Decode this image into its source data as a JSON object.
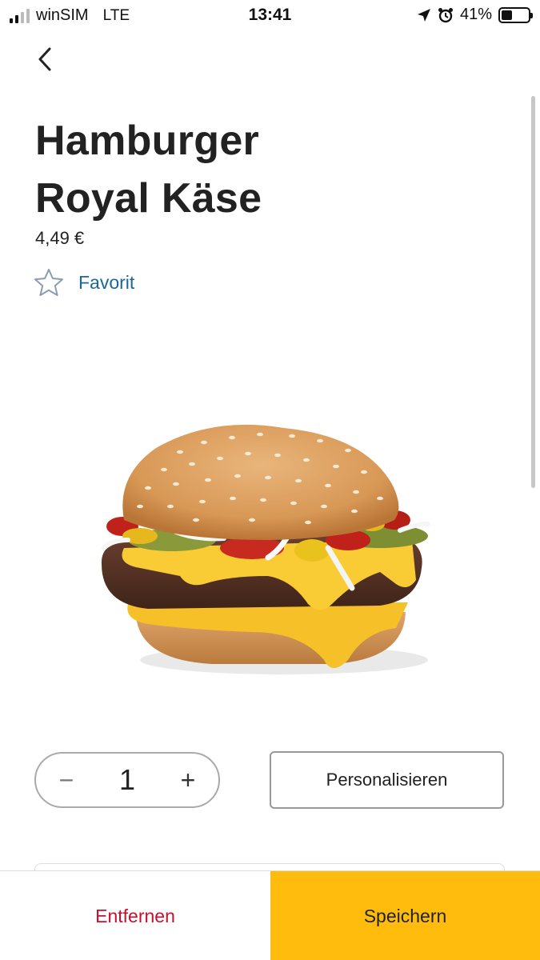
{
  "status_bar": {
    "carrier": "winSIM",
    "network": "LTE",
    "time": "13:41",
    "battery": "41%",
    "battery_level": 0.41
  },
  "product": {
    "name_line1": "Hamburger",
    "name_line2": "Royal Käse",
    "price": "4,49 €",
    "favorite_label": "Favorit"
  },
  "quantity": {
    "minus": "−",
    "value": "1",
    "plus": "+"
  },
  "actions": {
    "personalize": "Personalisieren",
    "remove": "Entfernen",
    "save": "Speichern"
  },
  "icons": {
    "back": "chevron-left-icon",
    "favorite": "star-outline-icon",
    "location": "location-arrow-icon",
    "alarm": "alarm-icon",
    "battery": "battery-icon",
    "signal": "signal-bars-icon"
  },
  "colors": {
    "brand_yellow": "#ffbc0d",
    "remove_red": "#c8102e",
    "link_blue": "#1b6796"
  }
}
